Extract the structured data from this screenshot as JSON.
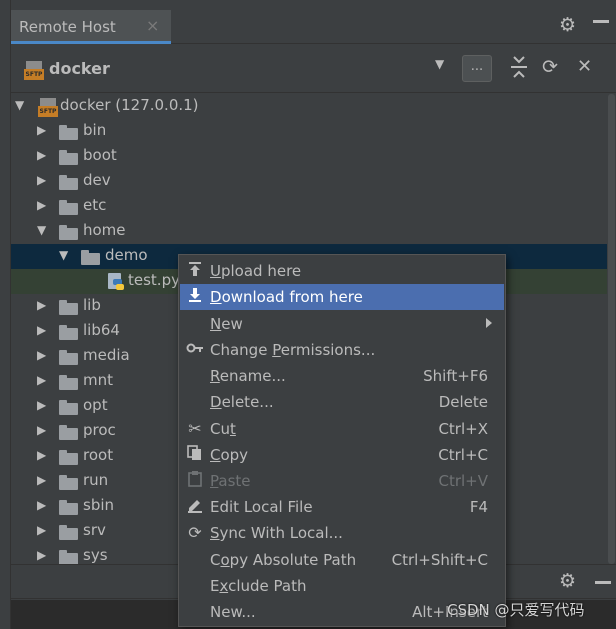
{
  "tab": {
    "title": "Remote Host",
    "close_icon": "close-icon"
  },
  "header_icons": [
    "gear-icon",
    "hide-icon"
  ],
  "toolbar": {
    "server_icon": "sftp-server-icon",
    "server_name": "docker",
    "dropdown_icon": "chevron-down-icon",
    "browse_label": "...",
    "collapse_icon": "collapse-all-icon",
    "refresh_icon": "refresh-icon",
    "close_icon": "close-icon"
  },
  "tree": {
    "root": "docker (127.0.0.1)",
    "items": [
      {
        "label": "bin",
        "expanded": false
      },
      {
        "label": "boot",
        "expanded": false
      },
      {
        "label": "dev",
        "expanded": false
      },
      {
        "label": "etc",
        "expanded": false
      },
      {
        "label": "home",
        "expanded": true
      },
      {
        "label": "demo",
        "expanded": true
      },
      {
        "label": "test.py",
        "type": "python-file"
      },
      {
        "label": "lib",
        "expanded": false
      },
      {
        "label": "lib64",
        "expanded": false
      },
      {
        "label": "media",
        "expanded": false
      },
      {
        "label": "mnt",
        "expanded": false
      },
      {
        "label": "opt",
        "expanded": false
      },
      {
        "label": "proc",
        "expanded": false
      },
      {
        "label": "root",
        "expanded": false
      },
      {
        "label": "run",
        "expanded": false
      },
      {
        "label": "sbin",
        "expanded": false
      },
      {
        "label": "srv",
        "expanded": false
      },
      {
        "label": "sys",
        "expanded": false
      }
    ]
  },
  "context_menu": {
    "items": [
      {
        "mn": "U",
        "rest": "pload here",
        "shortcut": "",
        "icon": "upload-icon"
      },
      {
        "mn": "D",
        "rest": "ownload from here",
        "shortcut": "",
        "icon": "download-icon",
        "state": "active"
      },
      {
        "mn": "N",
        "rest": "ew",
        "shortcut": "",
        "icon": "",
        "submenu": true
      },
      {
        "pre": "Change ",
        "mn": "P",
        "rest": "ermissions...",
        "shortcut": "",
        "icon": "key-icon"
      },
      {
        "mn": "R",
        "rest": "ename...",
        "shortcut": "Shift+F6",
        "icon": ""
      },
      {
        "mn": "D",
        "rest": "elete...",
        "shortcut": "Delete",
        "icon": ""
      },
      {
        "pre": "Cu",
        "mn": "t",
        "rest": "",
        "shortcut": "Ctrl+X",
        "icon": "scissors-icon"
      },
      {
        "mn": "C",
        "rest": "opy",
        "shortcut": "Ctrl+C",
        "icon": "copy-icon"
      },
      {
        "mn": "P",
        "rest": "aste",
        "shortcut": "Ctrl+V",
        "icon": "paste-icon",
        "state": "disabled"
      },
      {
        "pre": "",
        "mn": "",
        "rest": "Edit Local File",
        "shortcut": "F4",
        "icon": "edit-icon"
      },
      {
        "mn": "S",
        "rest": "ync With Local...",
        "shortcut": "",
        "icon": "sync-icon"
      },
      {
        "pre": "C",
        "mn": "o",
        "rest": "py Absolute Path",
        "shortcut": "Ctrl+Shift+C",
        "icon": ""
      },
      {
        "pre": "E",
        "mn": "x",
        "rest": "clude Path",
        "shortcut": "",
        "icon": ""
      },
      {
        "pre": "",
        "mn": "",
        "rest": "New...",
        "shortcut": "Alt+Insert",
        "icon": ""
      }
    ]
  },
  "bottom_icons": [
    "gear-icon",
    "hide-icon"
  ],
  "watermark": "CSDN @只爱写代码",
  "colors": {
    "selection": "#0d293e",
    "menu_highlight": "#4b6eaf",
    "sftp_badge": "#c57d26"
  }
}
